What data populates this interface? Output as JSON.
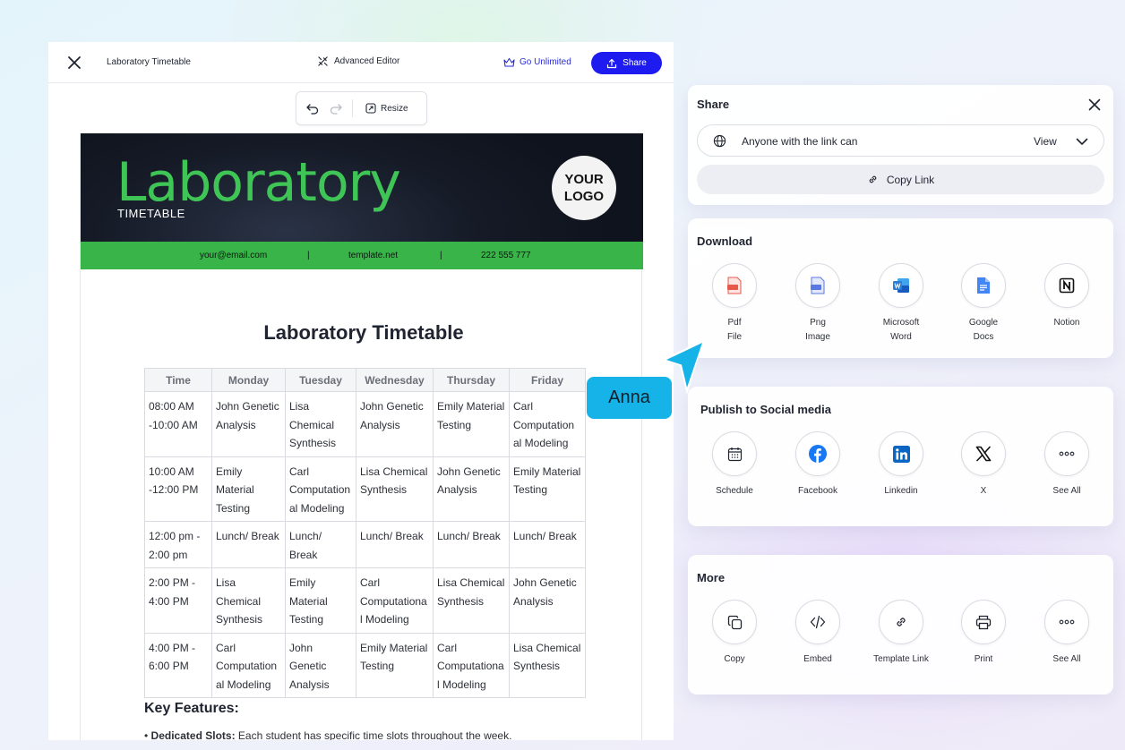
{
  "editor": {
    "doc_title": "Laboratory Timetable",
    "advanced_editor": "Advanced Editor",
    "go_unlimited": "Go Unlimited",
    "share": "Share",
    "resize": "Resize"
  },
  "document": {
    "banner_title": "Laboratory",
    "banner_subtitle": "TIMETABLE",
    "logo_line1": "YOUR",
    "logo_line2": "LOGO",
    "email": "your@email.com",
    "website": "template.net",
    "phone": "222 555 777",
    "separator": "|",
    "heading": "Laboratory Timetable",
    "table": {
      "headers": [
        "Time",
        "Monday",
        "Tuesday",
        "Wednesday",
        "Thursday",
        "Friday"
      ],
      "rows": [
        [
          "08:00 AM -10:00 AM",
          "John Genetic Analysis",
          "Lisa Chemical Synthesis",
          "John Genetic Analysis",
          "Emily Material Testing",
          "Carl Computation al Modeling"
        ],
        [
          "10:00 AM -12:00 PM",
          "Emily Material Testing",
          "Carl Computation al Modeling",
          "Lisa Chemical Synthesis",
          "John Genetic Analysis",
          "Emily Material Testing"
        ],
        [
          "12:00 pm - 2:00 pm",
          "Lunch/ Break",
          "Lunch/ Break",
          "Lunch/ Break",
          "Lunch/ Break",
          "Lunch/ Break"
        ],
        [
          "2:00 PM - 4:00 PM",
          "Lisa Chemical Synthesis",
          "Emily Material Testing",
          "Carl Computationa l Modeling",
          "Lisa Chemical Synthesis",
          "John Genetic Analysis"
        ],
        [
          "4:00 PM - 6:00 PM",
          "Carl Computation al Modeling",
          "John Genetic Analysis",
          "Emily Material Testing",
          "Carl Computationa l Modeling",
          "Lisa Chemical Synthesis"
        ]
      ]
    },
    "key_features": "Key Features:",
    "bullet_bold": "Dedicated Slots:",
    "bullet_text": " Each student has specific time slots throughout the week."
  },
  "share_panel": {
    "title": "Share",
    "access_label": "Anyone with the link can",
    "access_permission": "View",
    "copy_link": "Copy Link"
  },
  "download_panel": {
    "title": "Download",
    "options": [
      {
        "line1": "Pdf",
        "line2": "File",
        "icon": "pdf-file-icon"
      },
      {
        "line1": "Png",
        "line2": "Image",
        "icon": "png-image-icon"
      },
      {
        "line1": "Microsoft",
        "line2": "Word",
        "icon": "microsoft-word-icon"
      },
      {
        "line1": "Google",
        "line2": "Docs",
        "icon": "google-docs-icon"
      },
      {
        "line1": "Notion",
        "line2": "",
        "icon": "notion-icon"
      }
    ]
  },
  "social_panel": {
    "title": "Publish to Social media",
    "options": [
      "Schedule",
      "Facebook",
      "Linkedin",
      "X",
      "See All"
    ]
  },
  "more_panel": {
    "title": "More",
    "options": [
      "Copy",
      "Embed",
      "Template Link",
      "Print",
      "See All"
    ]
  },
  "collaborator": {
    "name": "Anna",
    "color": "#16b3e8"
  },
  "colors": {
    "brand_blue": "#1d1bf0",
    "lab_green": "#3fc556",
    "contact_bar": "#38b449"
  }
}
